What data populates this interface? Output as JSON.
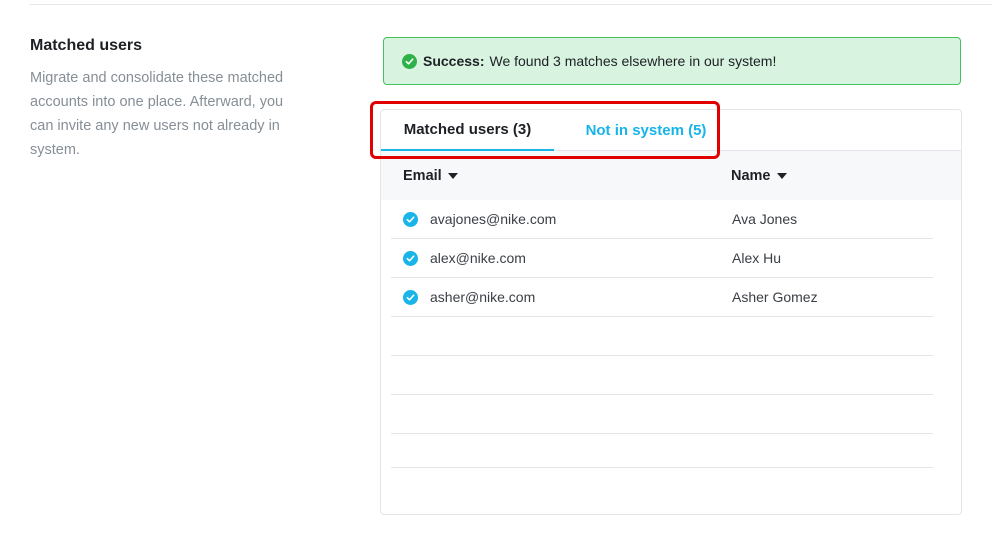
{
  "intro": {
    "title": "Matched users",
    "description": "Migrate and consolidate these matched accounts into one place. Afterward, you can invite any new users not already in system."
  },
  "alert": {
    "label": "Success:",
    "message": "We found 3 matches elsewhere in our system!",
    "icon": "check-circle-icon",
    "color": "#2fb14a",
    "background": "#d8f3df"
  },
  "tabs": {
    "matched": "Matched users (3)",
    "not_in_system": "Not in system (5)",
    "active": "matched",
    "accent": "#19b5e8"
  },
  "table": {
    "columns": {
      "email": "Email",
      "name": "Name"
    },
    "rows": [
      {
        "email": "avajones@nike.com",
        "name": "Ava Jones",
        "checked": true
      },
      {
        "email": "alex@nike.com",
        "name": "Alex Hu",
        "checked": true
      },
      {
        "email": "asher@nike.com",
        "name": "Asher Gomez",
        "checked": true
      }
    ]
  }
}
